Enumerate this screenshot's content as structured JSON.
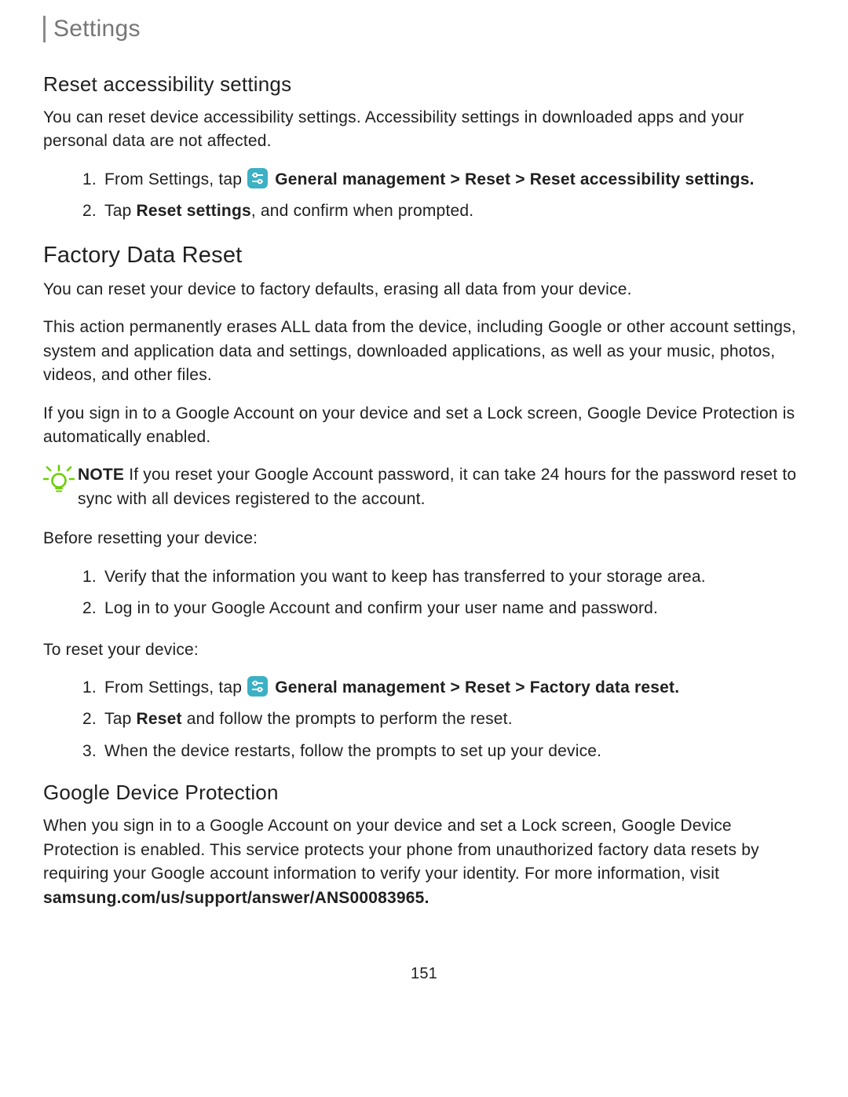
{
  "header": "Settings",
  "s1": {
    "title": "Reset accessibility settings",
    "intro": "You can reset device accessibility settings. Accessibility settings in downloaded apps and your personal data are not affected.",
    "step1_pre": "From Settings, tap ",
    "step1_bold": "General management > Reset > Reset accessibility settings",
    "step2_pre": "Tap ",
    "step2_bold": "Reset settings",
    "step2_post": ", and confirm when prompted."
  },
  "s2": {
    "title": "Factory Data Reset",
    "p1": "You can reset your device to factory defaults, erasing all data from your device.",
    "p2": "This action permanently erases ALL data from the device, including Google or other account settings, system and application data and settings, downloaded applications, as well as your music, photos, videos, and other files.",
    "p3": "If you sign in to a Google Account on your device and set a Lock screen, Google Device Protection is automatically enabled.",
    "note_label": "NOTE",
    "note_body": "If you reset your Google Account password, it can take 24 hours for the password reset to sync with all devices registered to the account.",
    "before": "Before resetting your device:",
    "b1": "Verify that the information you want to keep has transferred to your storage area.",
    "b2": "Log in to your Google Account and confirm your user name and password.",
    "toreset": "To reset your device:",
    "r1_pre": "From Settings, tap ",
    "r1_bold": "General management > Reset > Factory data reset",
    "r2_pre": "Tap ",
    "r2_bold": "Reset",
    "r2_post": " and follow the prompts to perform the reset.",
    "r3": "When the device restarts, follow the prompts to set up your device."
  },
  "s3": {
    "title": "Google Device Protection",
    "body_pre": "When you sign in to a Google Account on your device and set a Lock screen, Google Device Protection is enabled. This service protects your phone from unauthorized factory data resets by requiring your Google account information to verify your identity. For more information, visit ",
    "body_bold": "samsung.com/us/support/answer/ANS00083965"
  },
  "page_number": "151"
}
